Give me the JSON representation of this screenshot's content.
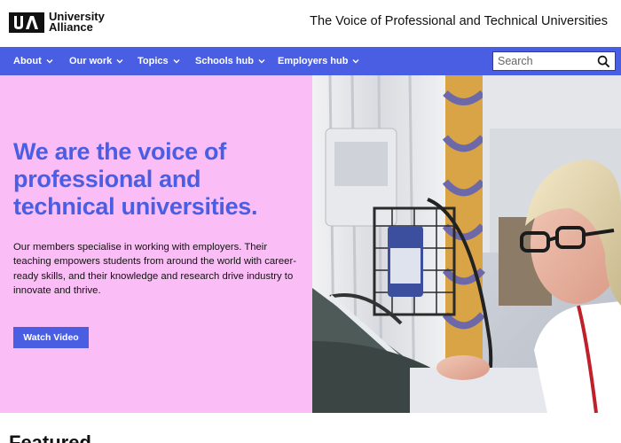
{
  "header": {
    "logo_line1": "University",
    "logo_line2": "Alliance",
    "tagline": "The Voice of Professional and Technical Universities"
  },
  "nav": {
    "items": [
      {
        "label": "About"
      },
      {
        "label": "Our work"
      },
      {
        "label": "Topics"
      },
      {
        "label": "Schools hub"
      },
      {
        "label": "Employers hub"
      }
    ],
    "search_placeholder": "Search"
  },
  "hero": {
    "title_line1": "We are the voice of",
    "title_line2": "professional and",
    "title_line3": "technical universities.",
    "body": "Our members specialise in working with employers. Their teaching empowers students from around the world with career-ready skills, and their knowledge and research drive industry to innovate and thrive.",
    "button_label": "Watch Video"
  },
  "featured": {
    "heading": "Featured"
  },
  "colors": {
    "brand_blue": "#4a5ee4",
    "hero_pink": "#fbbdf5"
  }
}
